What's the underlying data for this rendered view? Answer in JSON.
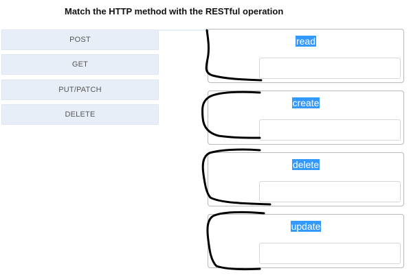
{
  "title": "Match the HTTP method with the RESTful operation",
  "methods": [
    "POST",
    "GET",
    "PUT/PATCH",
    "DELETE"
  ],
  "operations": [
    "read",
    "create",
    "delete",
    "update"
  ]
}
